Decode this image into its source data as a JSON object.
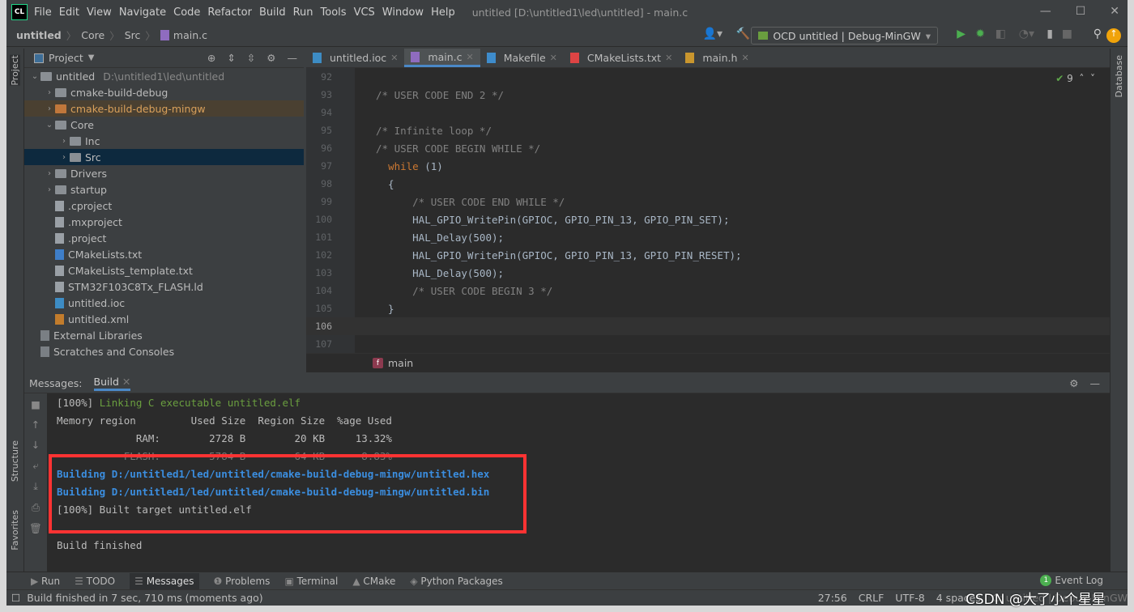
{
  "app": {
    "logo": "CL",
    "menu": [
      "File",
      "Edit",
      "View",
      "Navigate",
      "Code",
      "Refactor",
      "Build",
      "Run",
      "Tools",
      "VCS",
      "Window",
      "Help"
    ],
    "title": "untitled [D:\\untitled1\\led\\untitled] - main.c"
  },
  "breadcrumb": [
    "untitled",
    "Core",
    "Src",
    "main.c"
  ],
  "run_config": "OCD untitled | Debug-MinGW",
  "project": {
    "title": "Project",
    "strip_label": "Project",
    "tree": [
      {
        "label": "untitled",
        "path": "D:\\untitled1\\led\\untitled",
        "depth": 0,
        "arrow": "v",
        "kind": "folder"
      },
      {
        "label": "cmake-build-debug",
        "depth": 1,
        "arrow": ">",
        "kind": "folder"
      },
      {
        "label": "cmake-build-debug-mingw",
        "depth": 1,
        "arrow": ">",
        "kind": "folder-orange",
        "hl": true
      },
      {
        "label": "Core",
        "depth": 1,
        "arrow": "v",
        "kind": "folder"
      },
      {
        "label": "Inc",
        "depth": 2,
        "arrow": ">",
        "kind": "folder"
      },
      {
        "label": "Src",
        "depth": 2,
        "arrow": ">",
        "kind": "folder",
        "sel": true
      },
      {
        "label": "Drivers",
        "depth": 1,
        "arrow": ">",
        "kind": "folder"
      },
      {
        "label": "startup",
        "depth": 1,
        "arrow": ">",
        "kind": "folder"
      },
      {
        "label": ".cproject",
        "depth": 1,
        "kind": "file"
      },
      {
        "label": ".mxproject",
        "depth": 1,
        "kind": "file"
      },
      {
        "label": ".project",
        "depth": 1,
        "kind": "file"
      },
      {
        "label": "CMakeLists.txt",
        "depth": 1,
        "kind": "cmake"
      },
      {
        "label": "CMakeLists_template.txt",
        "depth": 1,
        "kind": "file"
      },
      {
        "label": "STM32F103C8Tx_FLASH.ld",
        "depth": 1,
        "kind": "file"
      },
      {
        "label": "untitled.ioc",
        "depth": 1,
        "kind": "ioc"
      },
      {
        "label": "untitled.xml",
        "depth": 1,
        "kind": "xml"
      },
      {
        "label": "External Libraries",
        "depth": 0,
        "kind": "lib"
      },
      {
        "label": "Scratches and Consoles",
        "depth": 0,
        "kind": "scratch"
      }
    ]
  },
  "editor": {
    "tabs": [
      {
        "label": "untitled.ioc"
      },
      {
        "label": "main.c",
        "active": true
      },
      {
        "label": "Makefile"
      },
      {
        "label": "CMakeLists.txt"
      },
      {
        "label": "main.h"
      }
    ],
    "inspections": "9",
    "lines": [
      {
        "n": "92",
        "html": ""
      },
      {
        "n": "93",
        "html": "<span class='cm'>/* USER CODE END 2 */</span>"
      },
      {
        "n": "94",
        "html": ""
      },
      {
        "n": "95",
        "html": "<span class='cm'>/* Infinite loop */</span>"
      },
      {
        "n": "96",
        "html": "<span class='cm'>/* USER CODE BEGIN WHILE */</span>"
      },
      {
        "n": "97",
        "html": "  <span class='kw'>while</span> (1)"
      },
      {
        "n": "98",
        "html": "  {"
      },
      {
        "n": "99",
        "html": "      <span class='cm'>/* USER CODE END WHILE */</span>"
      },
      {
        "n": "100",
        "html": "      HAL_GPIO_WritePin(GPIOC, GPIO_PIN_13, GPIO_PIN_SET);"
      },
      {
        "n": "101",
        "html": "      HAL_Delay(500);"
      },
      {
        "n": "102",
        "html": "      HAL_GPIO_WritePin(GPIOC, GPIO_PIN_13, GPIO_PIN_RESET);"
      },
      {
        "n": "103",
        "html": "      HAL_Delay(500);"
      },
      {
        "n": "104",
        "html": "      <span class='cm'>/* USER CODE BEGIN 3 */</span>"
      },
      {
        "n": "105",
        "html": "  }"
      },
      {
        "n": "106",
        "html": "",
        "cur": true
      },
      {
        "n": "107",
        "html": ""
      }
    ],
    "function_crumb": "main"
  },
  "right_strip": "Database",
  "left_strip": [
    "Structure",
    "Favorites"
  ],
  "build": {
    "tabs": [
      "Messages:",
      "Build"
    ],
    "lines": [
      {
        "t": "[100%] ",
        "g": "Linking C executable untitled.elf"
      },
      {
        "t": "Memory region         Used Size  Region Size  %age Used"
      },
      {
        "t": "             RAM:        2728 B        20 KB     13.32%"
      },
      {
        "t": "           FLASH:        5784 B        64 KB      8.83%"
      },
      {
        "b": "Building D:/untitled1/led/untitled/cmake-build-debug-mingw/untitled.hex"
      },
      {
        "b": "Building D:/untitled1/led/untitled/cmake-build-debug-mingw/untitled.bin"
      },
      {
        "t": "[100%] Built target untitled.elf"
      },
      {
        "t": ""
      },
      {
        "t": "Build finished"
      }
    ]
  },
  "toolwindows": [
    "Run",
    "TODO",
    "Messages",
    "Problems",
    "Terminal",
    "CMake",
    "Python Packages"
  ],
  "event_log": {
    "count": "1",
    "label": "Event Log"
  },
  "status": {
    "message": "Build finished in 7 sec, 710 ms (moments ago)",
    "position": "27:56",
    "line_sep": "CRLF",
    "encoding": "UTF-8",
    "indent": "4 spaces",
    "context": "C: untitled | Debug-MinGW"
  },
  "watermark": "CSDN @大了小个星星"
}
